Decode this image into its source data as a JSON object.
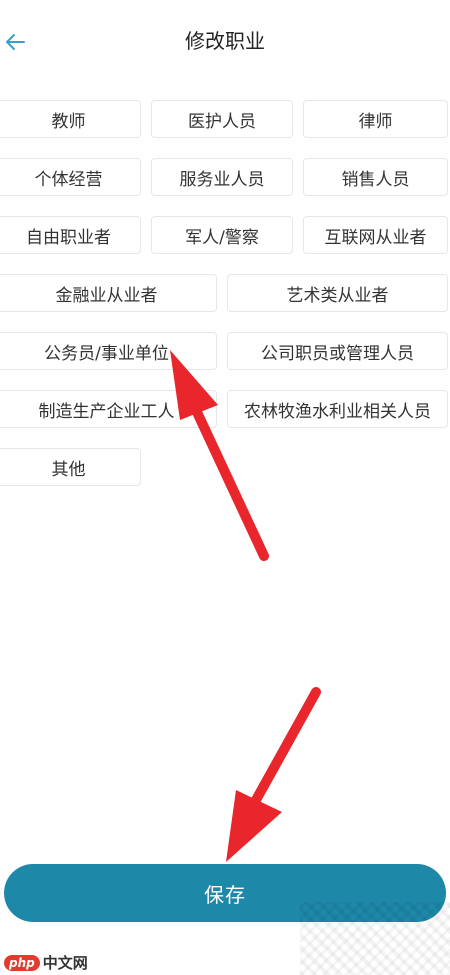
{
  "header": {
    "title": "修改职业",
    "back_icon": "arrow-left-icon"
  },
  "occupations": [
    "教师",
    "医护人员",
    "律师",
    "个体经营",
    "服务业人员",
    "销售人员",
    "自由职业者",
    "军人/警察",
    "互联网从业者",
    "金融业从业者",
    "艺术类从业者",
    "公务员/事业单位",
    "公司职员或管理人员",
    "制造生产企业工人",
    "农林牧渔水利业相关人员",
    "其他"
  ],
  "footer": {
    "save_label": "保存"
  },
  "watermark": {
    "logo": "php",
    "site": "中文网"
  },
  "colors": {
    "accent": "#1e88a8",
    "back_arrow": "#3aa0c8",
    "annotation_arrow": "#e8262b"
  }
}
